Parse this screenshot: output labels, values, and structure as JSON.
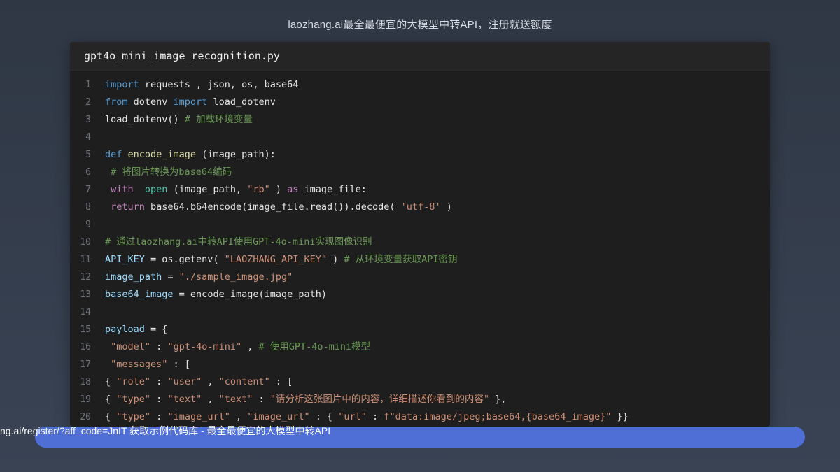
{
  "caption": "laozhang.ai最全最便宜的大模型中转API，注册就送额度",
  "file_title": "gpt4o_mini_image_recognition.py",
  "code_lines": [
    {
      "n": "1",
      "tokens": [
        {
          "t": "import",
          "c": "kw"
        },
        {
          "t": " requests , json, os, base64",
          "c": "plain"
        }
      ]
    },
    {
      "n": "2",
      "tokens": [
        {
          "t": "from",
          "c": "kw"
        },
        {
          "t": " dotenv ",
          "c": "plain"
        },
        {
          "t": "import",
          "c": "kw"
        },
        {
          "t": " load_dotenv",
          "c": "plain"
        }
      ]
    },
    {
      "n": "3",
      "tokens": [
        {
          "t": "load_dotenv() ",
          "c": "plain"
        },
        {
          "t": "# 加载环境变量",
          "c": "cm"
        }
      ]
    },
    {
      "n": "4",
      "tokens": []
    },
    {
      "n": "5",
      "tokens": [
        {
          "t": "def",
          "c": "kw"
        },
        {
          "t": " ",
          "c": "plain"
        },
        {
          "t": "encode_image",
          "c": "fn"
        },
        {
          "t": " (image_path):",
          "c": "plain"
        }
      ]
    },
    {
      "n": "6",
      "tokens": [
        {
          "t": " # 将图片转换为base64编码",
          "c": "cm"
        }
      ]
    },
    {
      "n": "7",
      "tokens": [
        {
          "t": " ",
          "c": "plain"
        },
        {
          "t": "with",
          "c": "kw2"
        },
        {
          "t": "  ",
          "c": "plain"
        },
        {
          "t": "open",
          "c": "bi"
        },
        {
          "t": " (image_path, ",
          "c": "plain"
        },
        {
          "t": "\"rb\"",
          "c": "str"
        },
        {
          "t": " ) ",
          "c": "plain"
        },
        {
          "t": "as",
          "c": "kw2"
        },
        {
          "t": " image_file:",
          "c": "plain"
        }
      ]
    },
    {
      "n": "8",
      "tokens": [
        {
          "t": " ",
          "c": "plain"
        },
        {
          "t": "return",
          "c": "kw2"
        },
        {
          "t": " base64.b64encode(image_file.read()).decode( ",
          "c": "plain"
        },
        {
          "t": "'utf-8'",
          "c": "str"
        },
        {
          "t": " )",
          "c": "plain"
        }
      ]
    },
    {
      "n": "9",
      "tokens": []
    },
    {
      "n": "10",
      "tokens": [
        {
          "t": "# 通过laozhang.ai中转API使用GPT-4o-mini实现图像识别",
          "c": "cm"
        }
      ]
    },
    {
      "n": "11",
      "tokens": [
        {
          "t": "API_KEY",
          "c": "var"
        },
        {
          "t": " = os.getenv( ",
          "c": "plain"
        },
        {
          "t": "\"LAOZHANG_API_KEY\"",
          "c": "str"
        },
        {
          "t": " ) ",
          "c": "plain"
        },
        {
          "t": "# 从环境变量获取API密钥",
          "c": "cm"
        }
      ]
    },
    {
      "n": "12",
      "tokens": [
        {
          "t": "image_path",
          "c": "var"
        },
        {
          "t": " = ",
          "c": "plain"
        },
        {
          "t": "\"./sample_image.jpg\"",
          "c": "str"
        }
      ]
    },
    {
      "n": "13",
      "tokens": [
        {
          "t": "base64_image",
          "c": "var"
        },
        {
          "t": " = encode_image(image_path)",
          "c": "plain"
        }
      ]
    },
    {
      "n": "14",
      "tokens": []
    },
    {
      "n": "15",
      "tokens": [
        {
          "t": "payload",
          "c": "var"
        },
        {
          "t": " = {",
          "c": "plain"
        }
      ]
    },
    {
      "n": "16",
      "tokens": [
        {
          "t": " ",
          "c": "plain"
        },
        {
          "t": "\"model\"",
          "c": "str"
        },
        {
          "t": " : ",
          "c": "plain"
        },
        {
          "t": "\"gpt-4o-mini\"",
          "c": "str"
        },
        {
          "t": " , ",
          "c": "plain"
        },
        {
          "t": "# 使用GPT-4o-mini模型",
          "c": "cm"
        }
      ]
    },
    {
      "n": "17",
      "tokens": [
        {
          "t": " ",
          "c": "plain"
        },
        {
          "t": "\"messages\"",
          "c": "str"
        },
        {
          "t": " : [",
          "c": "plain"
        }
      ]
    },
    {
      "n": "18",
      "tokens": [
        {
          "t": "{ ",
          "c": "plain"
        },
        {
          "t": "\"role\"",
          "c": "str"
        },
        {
          "t": " : ",
          "c": "plain"
        },
        {
          "t": "\"user\"",
          "c": "str"
        },
        {
          "t": " , ",
          "c": "plain"
        },
        {
          "t": "\"content\"",
          "c": "str"
        },
        {
          "t": " : [",
          "c": "plain"
        }
      ]
    },
    {
      "n": "19",
      "tokens": [
        {
          "t": "{ ",
          "c": "plain"
        },
        {
          "t": "\"type\"",
          "c": "str"
        },
        {
          "t": " : ",
          "c": "plain"
        },
        {
          "t": "\"text\"",
          "c": "str"
        },
        {
          "t": " , ",
          "c": "plain"
        },
        {
          "t": "\"text\"",
          "c": "str"
        },
        {
          "t": " : ",
          "c": "plain"
        },
        {
          "t": "\"请分析这张图片中的内容，详细描述你看到的内容\"",
          "c": "str"
        },
        {
          "t": " },",
          "c": "plain"
        }
      ]
    },
    {
      "n": "20",
      "tokens": [
        {
          "t": "{ ",
          "c": "plain"
        },
        {
          "t": "\"type\"",
          "c": "str"
        },
        {
          "t": " : ",
          "c": "plain"
        },
        {
          "t": "\"image_url\"",
          "c": "str"
        },
        {
          "t": " , ",
          "c": "plain"
        },
        {
          "t": "\"image_url\"",
          "c": "str"
        },
        {
          "t": " : { ",
          "c": "plain"
        },
        {
          "t": "\"url\"",
          "c": "str"
        },
        {
          "t": " : ",
          "c": "plain"
        },
        {
          "t": "f\"data:image/jpeg;base64,{base64_image}\"",
          "c": "str"
        },
        {
          "t": " }}",
          "c": "plain"
        }
      ]
    }
  ],
  "bottom_link_text": "ng.ai/register/?aff_code=JnIT 获取示例代码库 - 最全最便宜的大模型中转API",
  "colors": {
    "background": "#333c4a",
    "editor": "#1e1e1e",
    "bar": "#4f6fd6"
  }
}
